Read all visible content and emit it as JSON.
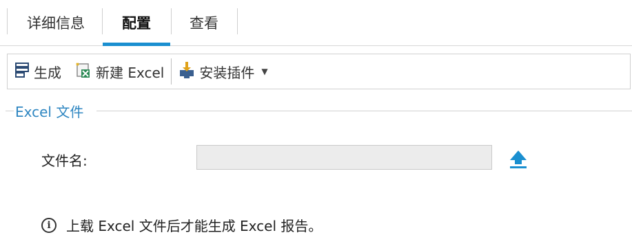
{
  "tabs": [
    {
      "label": "详细信息",
      "active": false
    },
    {
      "label": "配置",
      "active": true
    },
    {
      "label": "查看",
      "active": false
    }
  ],
  "toolbar": {
    "generate_label": "生成",
    "new_excel_label": "新建 Excel",
    "install_plugin_label": "安装插件"
  },
  "group": {
    "title": "Excel 文件"
  },
  "form": {
    "filename_label": "文件名:",
    "filename_value": "",
    "filename_placeholder": ""
  },
  "info": {
    "message": "上载 Excel 文件后才能生成 Excel 报告。"
  },
  "colors": {
    "accent": "#1a8fd0",
    "group_title": "#2e86c1",
    "input_bg": "#ececec"
  },
  "icons": {
    "generate": "report-generate-icon",
    "new_excel": "excel-new-icon",
    "install_plugin": "install-download-icon",
    "upload": "upload-arrow-icon",
    "info": "info-icon"
  }
}
